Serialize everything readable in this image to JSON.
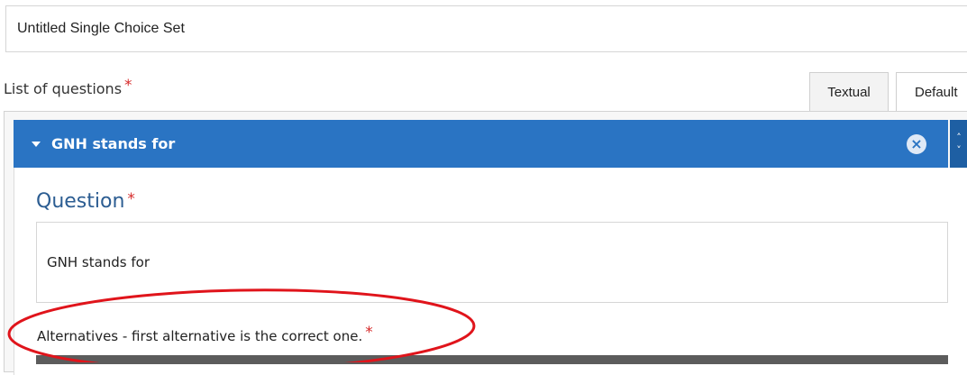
{
  "title_input": {
    "value": "Untitled Single Choice Set"
  },
  "list": {
    "label": "List of questions",
    "required_marker": "*"
  },
  "tabs": [
    {
      "label": "Textual"
    },
    {
      "label": "Default"
    }
  ],
  "question_item": {
    "header": "GNH stands for",
    "icons": {
      "collapse": "caret-down-icon",
      "remove": "remove-circle-icon",
      "order": "order-up-down-icon"
    },
    "colors": {
      "header_bg": "#2a74c3"
    }
  },
  "question_field": {
    "label": "Question",
    "required_marker": "*",
    "value": "GNH stands for"
  },
  "alternatives": {
    "label": "Alternatives - first alternative is the correct one.",
    "required_marker": "*"
  },
  "annotation": {
    "color": "#e0141b"
  }
}
